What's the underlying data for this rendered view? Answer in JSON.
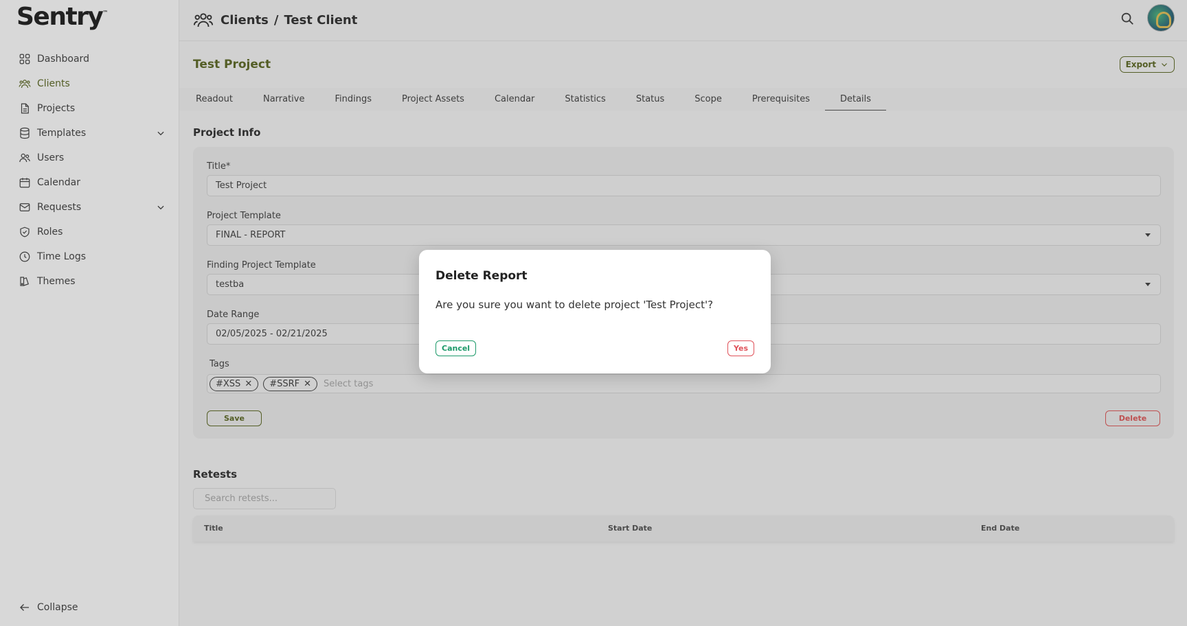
{
  "brand": {
    "logo_text": "Sentry",
    "tm": "™"
  },
  "sidebar": {
    "items": [
      {
        "label": "Dashboard",
        "icon": "dashboard-icon"
      },
      {
        "label": "Clients",
        "icon": "users-group-icon",
        "active": true
      },
      {
        "label": "Projects",
        "icon": "document-icon"
      },
      {
        "label": "Templates",
        "icon": "database-icon",
        "expandable": true
      },
      {
        "label": "Users",
        "icon": "users-icon"
      },
      {
        "label": "Calendar",
        "icon": "calendar-icon"
      },
      {
        "label": "Requests",
        "icon": "mail-icon",
        "expandable": true
      },
      {
        "label": "Roles",
        "icon": "shield-icon"
      },
      {
        "label": "Time Logs",
        "icon": "clock-icon"
      },
      {
        "label": "Themes",
        "icon": "themes-icon"
      }
    ],
    "collapse_label": "Collapse"
  },
  "header": {
    "breadcrumb": [
      "Clients",
      "Test Client"
    ],
    "separator": "/",
    "icons": [
      "users-group-icon",
      "search-icon",
      "avatar"
    ]
  },
  "project": {
    "title": "Test Project",
    "export_label": "Export",
    "tabs": [
      "Readout",
      "Narrative",
      "Findings",
      "Project Assets",
      "Calendar",
      "Statistics",
      "Status",
      "Scope",
      "Prerequisites",
      "Details"
    ],
    "active_tab": "Details"
  },
  "project_info": {
    "heading": "Project Info",
    "title_label": "Title*",
    "title_value": "Test Project",
    "template_label": "Project Template",
    "template_value": "FINAL - REPORT",
    "finding_template_label": "Finding Project Template",
    "finding_template_value": "testba",
    "date_label": "Date Range",
    "date_value": "02/05/2025 - 02/21/2025",
    "tags_label": "Tags",
    "tags": [
      {
        "label": "#XSS",
        "remove": "✕"
      },
      {
        "label": "#SSRF",
        "remove": "✕"
      }
    ],
    "tags_placeholder": "Select tags",
    "save_label": "Save",
    "delete_label": "Delete"
  },
  "retests": {
    "heading": "Retests",
    "search_placeholder": "Search retests...",
    "columns": [
      "Title",
      "Start Date",
      "End Date"
    ]
  },
  "modal": {
    "title": "Delete Report",
    "body": "Are you sure you want to delete project 'Test Project'?",
    "cancel_label": "Cancel",
    "yes_label": "Yes"
  },
  "colors": {
    "accent": "#4f5b16",
    "danger": "#d04a4a",
    "confirm_green": "#1d9a6a"
  }
}
